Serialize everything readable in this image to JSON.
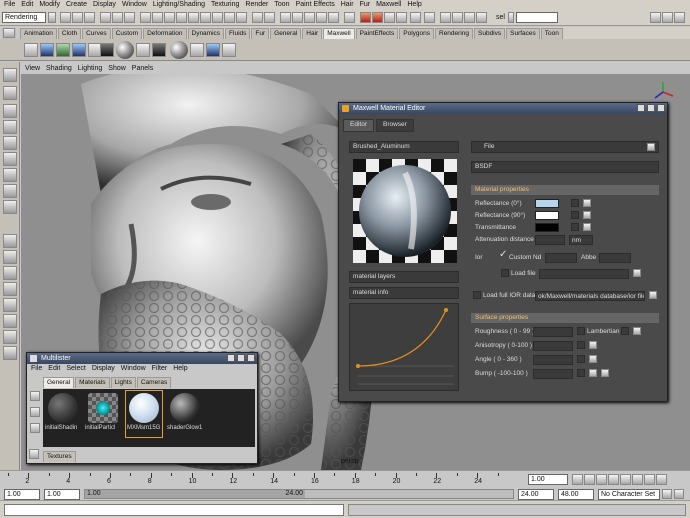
{
  "menu": [
    "File",
    "Edit",
    "Modify",
    "Create",
    "Display",
    "Window",
    "Lighting/Shading",
    "Texturing",
    "Render",
    "Toon",
    "Paint Effects",
    "Hair",
    "Fur",
    "Maxwell",
    "Help"
  ],
  "status": {
    "mode": "Rendering",
    "sel_label": "sel"
  },
  "shelf_tabs": [
    "Animation",
    "Cloth",
    "Curves",
    "Custom",
    "Deformation",
    "Dynamics",
    "Fluids",
    "Fur",
    "General",
    "Hair",
    "Maxwell",
    "PaintEffects",
    "Polygons",
    "Rendering",
    "Subdivs",
    "Surfaces",
    "Toon"
  ],
  "shelf_active": "Maxwell",
  "viewport": {
    "menu": [
      "View",
      "Shading",
      "Lighting",
      "Show",
      "Panels"
    ],
    "camera_label": "persp"
  },
  "mme": {
    "title": "Maxwell Material Editor",
    "tabs": [
      "Editor",
      "Browser"
    ],
    "material_name": "Brushed_Aluminum",
    "file_menu": "File",
    "bsdf_label": "BSDF",
    "material_layers": "material layers",
    "material_info": "material info",
    "material_properties": "Material properties",
    "props": {
      "refl0": "Reflectance (0°)",
      "refl90": "Reflectance (90°)",
      "transmittance": "Transmittance",
      "attenuation": "Attenuation distance",
      "att_unit": "nm",
      "ior": "Ior",
      "custom": "Custom",
      "nd": "Nd",
      "abbe": "Abbe",
      "load_file": "Load file",
      "load_ior": "Load full IOR data",
      "ior_path": "ok/Maxwell/materials database/ior files/al.ior"
    },
    "surface_properties": "Surface properties",
    "surface": {
      "roughness": "Roughness ( 0 - 99 )",
      "lambertian": "Lambertian",
      "anisotropy": "Anisotropy ( 0-100 )",
      "angle": "Angle ( 0 - 360 )",
      "bump": "Bump ( -100-100 )"
    },
    "colors": {
      "refl0": "#b8d4ec",
      "refl90": "#ffffff",
      "transmittance": "#000000"
    }
  },
  "multilister": {
    "title": "Multilister",
    "menu": [
      "File",
      "Edit",
      "Select",
      "Display",
      "Window",
      "Filter",
      "Help"
    ],
    "tabs": [
      "General",
      "Materials",
      "Lights",
      "Cameras"
    ],
    "swatches": [
      "initialShadin",
      "initialParticl",
      "MXMsm15G",
      "shaderGlow1"
    ],
    "bottom_tab": "Textures"
  },
  "timeline": {
    "ticks": [
      "2",
      "4",
      "6",
      "8",
      "10",
      "12",
      "14",
      "16",
      "18",
      "20",
      "22",
      "24"
    ],
    "current_frame": "1.00"
  },
  "range": {
    "start": "1.00",
    "inner_start": "1.00",
    "slider_start": "1.00",
    "slider_end": "24.00",
    "inner_end": "24.00",
    "end": "48.00",
    "character_set": "No Character Set"
  }
}
